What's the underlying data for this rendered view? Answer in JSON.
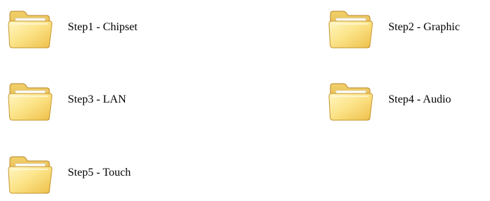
{
  "folders": [
    {
      "label": "Step1 - Chipset",
      "icon": "folder-icon"
    },
    {
      "label": "Step2 - Graphic",
      "icon": "folder-icon"
    },
    {
      "label": "Step3 - LAN",
      "icon": "folder-icon"
    },
    {
      "label": "Step4 - Audio",
      "icon": "folder-icon"
    },
    {
      "label": "Step5 - Touch",
      "icon": "folder-icon"
    }
  ],
  "colors": {
    "folder_light": "#FFF2A8",
    "folder_mid": "#F7D86A",
    "folder_dark": "#D9A932",
    "folder_edge": "#B8862A",
    "background": "#FFFFFF",
    "text": "#000000"
  }
}
